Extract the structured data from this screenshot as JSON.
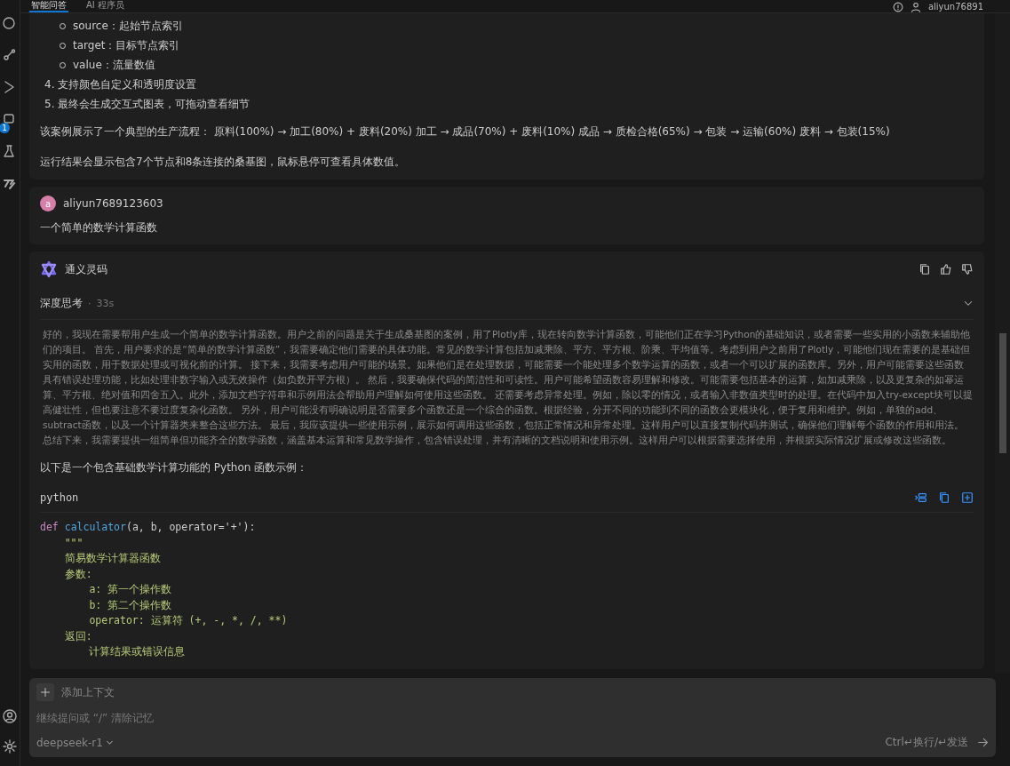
{
  "activity_bar": {
    "badge": "1"
  },
  "top_bar": {
    "tabs": [
      {
        "label": "智能问答",
        "selected": true
      },
      {
        "label": "AI 程序员",
        "selected": false
      }
    ],
    "user": "aliyun76891"
  },
  "messages": [
    {
      "kind": "assistant_tail",
      "sub_items": [
        "source：起始节点索引",
        "target：目标节点索引",
        "value：流量数值"
      ],
      "numbered": [
        {
          "number": "4.",
          "text": "支持颜色自定义和透明度设置"
        },
        {
          "number": "5.",
          "text": "最终会生成交互式图表，可拖动查看细节"
        }
      ],
      "paragraphs": [
        "该案例展示了一个典型的生产流程： 原料(100%) → 加工(80%) + 废料(20%) 加工 → 成品(70%) + 废料(10%) 成品 → 质检合格(65%) → 包装 → 运输(60%) 废料 → 包装(15%)",
        "运行结果会显示包含7个节点和8条连接的桑基图，鼠标悬停可查看具体数值。"
      ]
    },
    {
      "kind": "user",
      "avatar_letter": "a",
      "author": "aliyun7689123603",
      "text": "一个简单的数学计算函数"
    },
    {
      "kind": "assistant",
      "author": "通义灵码",
      "thinking": {
        "label": "深度思考",
        "separator": "·",
        "duration": "33s",
        "expanded": true,
        "lines": [
          "好的，我现在需要帮用户生成一个简单的数学计算函数。用户之前的问题是关于生成桑基图的案例，用了Plotly库，现在转向数学计算函数，可能他们正在学习Python的基础知识，或者需要一些实用的小函数来辅助他",
          "们的项目。 首先，用户要求的是“简单的数学计算函数”，我需要确定他们需要的具体功能。常见的数学计算包括加减乘除、平方、平方根、阶乘、平均值等。考虑到用户之前用了Plotly，可能他们现在需要的是基础但",
          "实用的函数，用于数据处理或可视化前的计算。 接下来，我需要考虑用户可能的场景。如果他们是在处理数据，可能需要一个能处理多个数学运算的函数，或者一个可以扩展的函数库。另外，用户可能需要这些函数",
          "具有错误处理功能，比如处理非数字输入或无效操作（如负数开平方根）。 然后，我要确保代码的简洁性和可读性。用户可能希望函数容易理解和修改。可能需要包括基本的运算，如加减乘除，以及更复杂的如幂运",
          "算、平方根、绝对值和四舍五入。此外，添加文档字符串和示例用法会帮助用户理解如何使用这些函数。 还需要考虑异常处理。例如，除以零的情况，或者输入非数值类型时的处理。在代码中加入try-except块可以提",
          "高健壮性，但也要注意不要过度复杂化函数。 另外，用户可能没有明确说明是否需要多个函数还是一个综合的函数。根据经验，分开不同的功能到不同的函数会更模块化，便于复用和维护。例如，单独的add、",
          "subtract函数，以及一个计算器类来整合这些方法。 最后，我应该提供一些使用示例，展示如何调用这些函数，包括正常情况和异常处理。这样用户可以直接复制代码并测试，确保他们理解每个函数的作用和用法。",
          "总结下来，我需要提供一组简单但功能齐全的数学函数，涵盖基本运算和常见数学操作，包含错误处理，并有清晰的文档说明和使用示例。这样用户可以根据需要选择使用，并根据实际情况扩展或修改这些函数。"
        ]
      },
      "intro": "以下是一个包含基础数学计算功能的 Python 函数示例：",
      "code": {
        "language": "python",
        "lines": [
          [
            {
              "text": "def ",
              "kind": "keyword"
            },
            {
              "text": "calculator",
              "kind": "function"
            },
            {
              "text": "(a, b, operator='+'):",
              "kind": "plain"
            }
          ],
          [
            {
              "text": "    \"\"\"",
              "kind": "string"
            }
          ],
          [
            {
              "text": "    简易数学计算器函数",
              "kind": "string"
            }
          ],
          [
            {
              "text": "    参数:",
              "kind": "string"
            }
          ],
          [
            {
              "text": "        a: 第一个操作数",
              "kind": "string"
            }
          ],
          [
            {
              "text": "        b: 第二个操作数",
              "kind": "string"
            }
          ],
          [
            {
              "text": "        operator: 运算符 (+, -, *, /, **)",
              "kind": "string"
            }
          ],
          [
            {
              "text": "    返回:",
              "kind": "string"
            }
          ],
          [
            {
              "text": "        计算结果或错误信息",
              "kind": "string"
            }
          ]
        ]
      }
    }
  ],
  "input": {
    "add_context": "添加上下文",
    "placeholder": "继续提问或 “/” 清除记忆",
    "model": "deepseek-r1",
    "hint": "Ctrl↵换行/↵发送"
  }
}
